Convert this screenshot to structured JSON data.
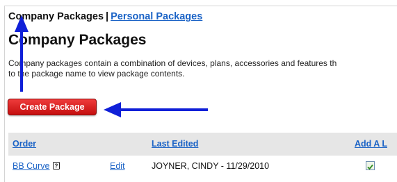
{
  "nav": {
    "current": "Company Packages",
    "separator": "|",
    "other_link": "Personal Packages"
  },
  "page": {
    "title": "Company Packages",
    "description_line1": "Company packages contain a combination of devices, plans, accessories and features th",
    "description_line2": "to the package name to view package contents."
  },
  "actions": {
    "create_label": "Create Package"
  },
  "table": {
    "columns": [
      "Order",
      "Last Edited",
      "Add A L"
    ],
    "rows": [
      {
        "package": "BB Curve",
        "action": "Edit",
        "last_edited": "JOYNER, CINDY  -  11/29/2010",
        "checked": true
      }
    ]
  },
  "annotations": {
    "arrow_color": "#1020d8"
  }
}
